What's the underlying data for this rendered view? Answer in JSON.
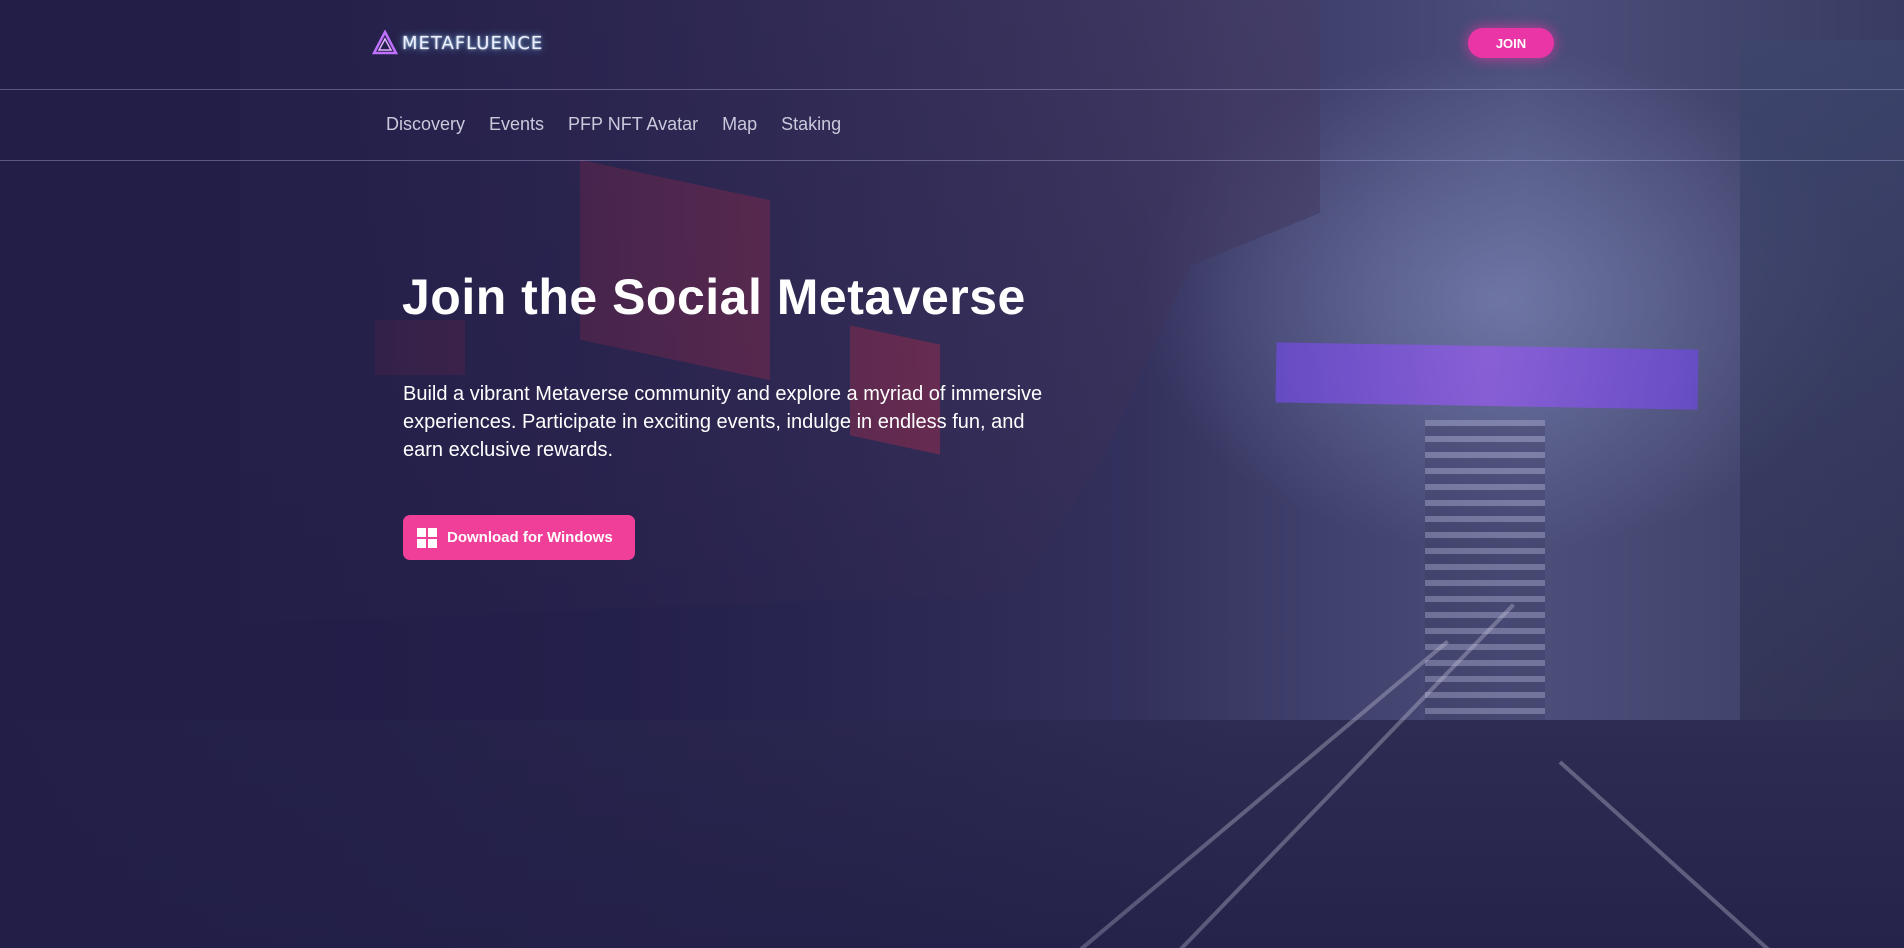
{
  "header": {
    "logo_text": "METAFLUENCE",
    "join_label": "JOIN"
  },
  "nav": {
    "items": [
      "Discovery",
      "Events",
      "PFP NFT Avatar",
      "Map",
      "Staking"
    ]
  },
  "hero": {
    "title": "Join the Social Metaverse",
    "description": "Build a vibrant Metaverse community and explore a myriad of immersive experiences. Participate in exciting events, indulge in endless fun, and earn exclusive rewards.",
    "download_label": "Download for Windows",
    "download_icon": "windows-icon"
  },
  "colors": {
    "background": "#23204a",
    "accent_pink": "#f03f98",
    "join_pink": "#e935a6"
  }
}
